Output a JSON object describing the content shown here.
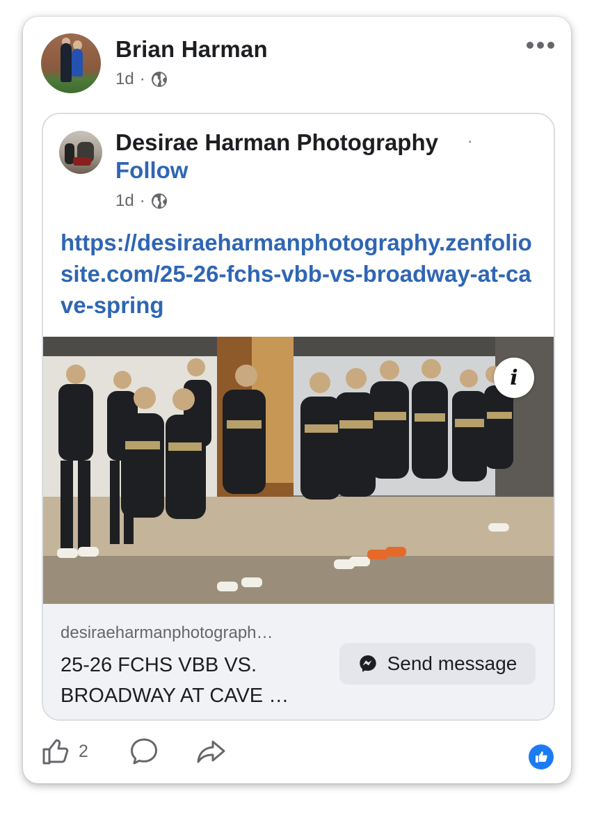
{
  "post": {
    "author": "Brian Harman",
    "time": "1d",
    "separator": "·",
    "likes": "2"
  },
  "shared": {
    "author": "Desirae Harman Photography",
    "dot": "·",
    "follow": "Follow",
    "time": "1d",
    "separator": "·",
    "link": "https://desiraeharmanphotography.zenfoliosite.com/25-26-fchs-vbb-vs-broadway-at-cave-spring",
    "info": "i"
  },
  "preview": {
    "domain": "desiraeharmanphotograph…",
    "title": "25-26 FCHS VBB VS. BROADWAY AT CAVE …",
    "send_label": "Send message"
  },
  "colors": {
    "link": "#2f66b3",
    "reaction": "#1d7bf2"
  }
}
